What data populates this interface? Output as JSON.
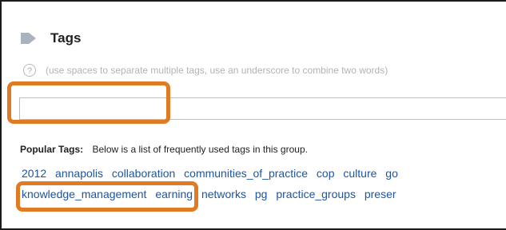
{
  "section": {
    "title": "Tags",
    "help_icon_glyph": "?",
    "help_text": "(use spaces to separate multiple tags, use an underscore to combine two words)",
    "input_value": "",
    "icon": "tag-icon"
  },
  "popular": {
    "label": "Popular Tags:",
    "description": "Below is a list of frequently used tags in this group.",
    "row1": [
      "2012",
      "annapolis",
      "collaboration",
      "communities_of_practice",
      "cop",
      "culture",
      "go"
    ],
    "row2": [
      "knowledge_management",
      "earning",
      "networks",
      "pg",
      "practice_groups",
      "preser"
    ]
  },
  "colors": {
    "accent": "#e07a23",
    "link": "#1a56a5"
  }
}
